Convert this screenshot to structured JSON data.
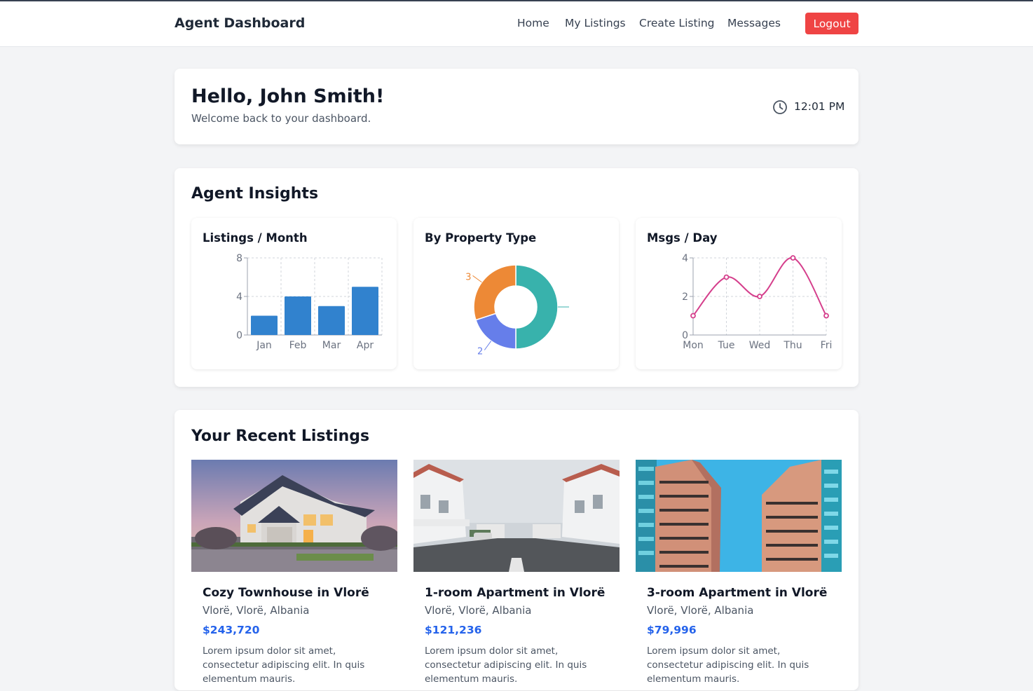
{
  "navbar": {
    "brand": "Agent Dashboard",
    "links": [
      "Home",
      "My Listings",
      "Create Listing",
      "Messages"
    ],
    "logout_label": "Logout",
    "logout_color": "#ef4444"
  },
  "welcome": {
    "title": "Hello, John Smith!",
    "subtitle": "Welcome back to your dashboard.",
    "time": "12:01 PM",
    "time_icon": "clock-icon"
  },
  "insights": {
    "title": "Agent Insights",
    "charts": [
      {
        "title": "Listings / Month"
      },
      {
        "title": "By Property Type"
      },
      {
        "title": "Msgs / Day"
      }
    ]
  },
  "chart_data": [
    {
      "type": "bar",
      "title": "Listings / Month",
      "categories": [
        "Jan",
        "Feb",
        "Mar",
        "Apr"
      ],
      "values": [
        2,
        4,
        3,
        5
      ],
      "ylim": [
        0,
        8
      ],
      "yticks": [
        0,
        4,
        8
      ],
      "grid": true,
      "color": "#3182ce"
    },
    {
      "type": "pie",
      "title": "By Property Type",
      "donut": true,
      "slices": [
        {
          "value": 5,
          "color": "#38b2ac",
          "label": ""
        },
        {
          "value": 2,
          "color": "#667eea",
          "label": "2"
        },
        {
          "value": 3,
          "color": "#ed8936",
          "label": "3"
        }
      ]
    },
    {
      "type": "line",
      "title": "Msgs / Day",
      "categories": [
        "Mon",
        "Tue",
        "Wed",
        "Thu",
        "Fri"
      ],
      "values": [
        1,
        3,
        2,
        4,
        1
      ],
      "ylim": [
        0,
        4
      ],
      "yticks": [
        0,
        2,
        4
      ],
      "grid": true,
      "color": "#d53f8c"
    }
  ],
  "listings": {
    "title": "Your Recent Listings",
    "items": [
      {
        "title": "Cozy Townhouse in Vlorë",
        "location": "Vlorë, Vlorë, Albania",
        "price": "$243,720",
        "description": "Lorem ipsum dolor sit amet, consectetur adipiscing elit. In quis elementum mauris."
      },
      {
        "title": "1-room Apartment in Vlorë",
        "location": "Vlorë, Vlorë, Albania",
        "price": "$121,236",
        "description": "Lorem ipsum dolor sit amet, consectetur adipiscing elit. In quis elementum mauris."
      },
      {
        "title": "3-room Apartment in Vlorë",
        "location": "Vlorë, Vlorë, Albania",
        "price": "$79,996",
        "description": "Lorem ipsum dolor sit amet, consectetur adipiscing elit. In quis elementum mauris."
      }
    ]
  }
}
